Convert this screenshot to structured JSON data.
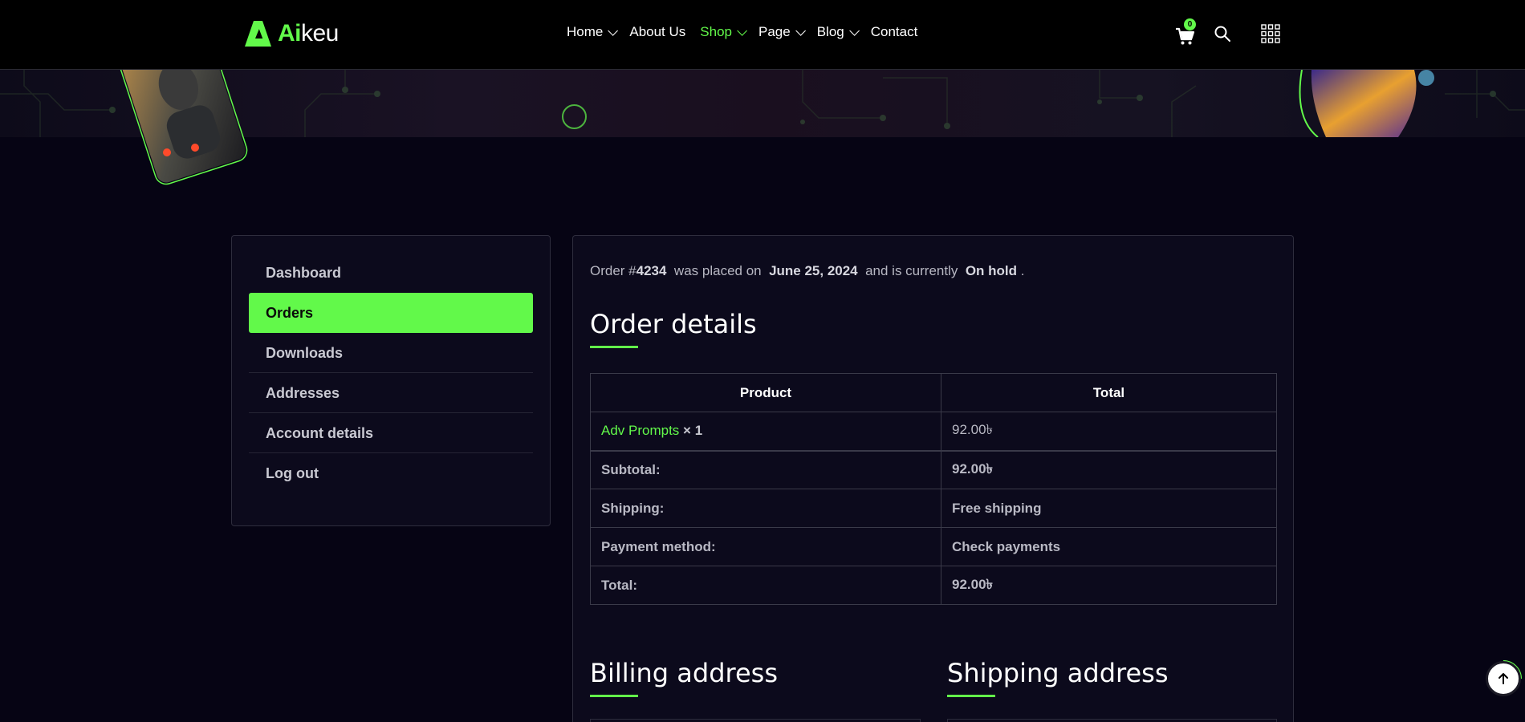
{
  "header": {
    "logo": {
      "ai": "Ai",
      "rest": "keu"
    },
    "nav": [
      {
        "label": "Home",
        "dropdown": true,
        "active": false
      },
      {
        "label": "About Us",
        "dropdown": false,
        "active": false
      },
      {
        "label": "Shop",
        "dropdown": true,
        "active": true
      },
      {
        "label": "Page",
        "dropdown": true,
        "active": false
      },
      {
        "label": "Blog",
        "dropdown": true,
        "active": false
      },
      {
        "label": "Contact",
        "dropdown": false,
        "active": false
      }
    ],
    "cart_count": "0",
    "icons": {
      "cart": "cart-icon",
      "search": "search-icon",
      "menu": "grid-menu-icon"
    }
  },
  "sidebar": {
    "items": [
      {
        "label": "Dashboard",
        "active": false
      },
      {
        "label": "Orders",
        "active": true
      },
      {
        "label": "Downloads",
        "active": false
      },
      {
        "label": "Addresses",
        "active": false
      },
      {
        "label": "Account details",
        "active": false
      },
      {
        "label": "Log out",
        "active": false
      }
    ]
  },
  "order": {
    "notice": {
      "p1": "Order #",
      "number": "4234",
      "p2": "was placed on",
      "date": "June 25, 2024",
      "p3": "and is currently",
      "status": "On hold",
      "p4": "."
    },
    "details_title": "Order details",
    "table": {
      "headers": [
        "Product",
        "Total"
      ],
      "product": {
        "name": "Adv Prompts",
        "qty": "× 1",
        "total": "92.00৳"
      },
      "rows": [
        {
          "label": "Subtotal:",
          "value": "92.00৳"
        },
        {
          "label": "Shipping:",
          "value": "Free shipping"
        },
        {
          "label": "Payment method:",
          "value": "Check payments"
        },
        {
          "label": "Total:",
          "value": "92.00৳"
        }
      ]
    },
    "billing_title": "Billing address",
    "shipping_title": "Shipping address"
  },
  "colors": {
    "accent": "#62f94a",
    "bg": "#060414",
    "panel": "#0c0a1c"
  }
}
